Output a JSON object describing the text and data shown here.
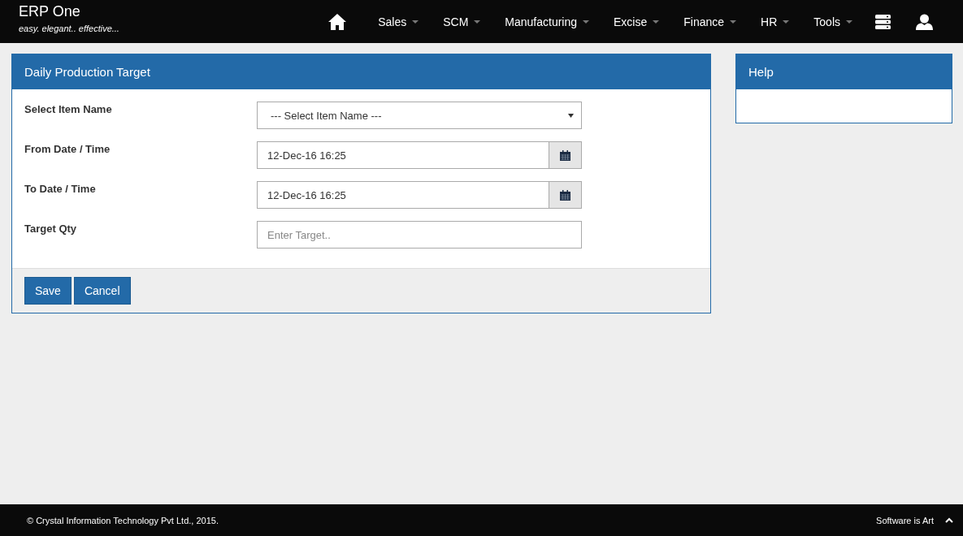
{
  "brand": {
    "title": "ERP One",
    "tagline": "easy. elegant.. effective..."
  },
  "nav": [
    {
      "label": "Sales"
    },
    {
      "label": "SCM"
    },
    {
      "label": "Manufacturing"
    },
    {
      "label": "Excise"
    },
    {
      "label": "Finance"
    },
    {
      "label": "HR"
    },
    {
      "label": "Tools"
    }
  ],
  "form": {
    "title": "Daily Production Target",
    "fields": [
      {
        "kind": "select",
        "label": "Select Item Name",
        "value": "--- Select Item Name ---"
      },
      {
        "kind": "date",
        "label": "From Date / Time",
        "value": "12-Dec-16 16:25"
      },
      {
        "kind": "date",
        "label": "To Date / Time",
        "value": "12-Dec-16 16:25"
      },
      {
        "kind": "text",
        "label": "Target Qty",
        "placeholder": "Enter Target.."
      }
    ],
    "buttons": [
      "Save",
      "Cancel"
    ]
  },
  "help": {
    "title": "Help"
  },
  "footer": {
    "copyright": "© Crystal Information Technology Pvt Ltd., 2015.",
    "motto": "Software is Art"
  }
}
